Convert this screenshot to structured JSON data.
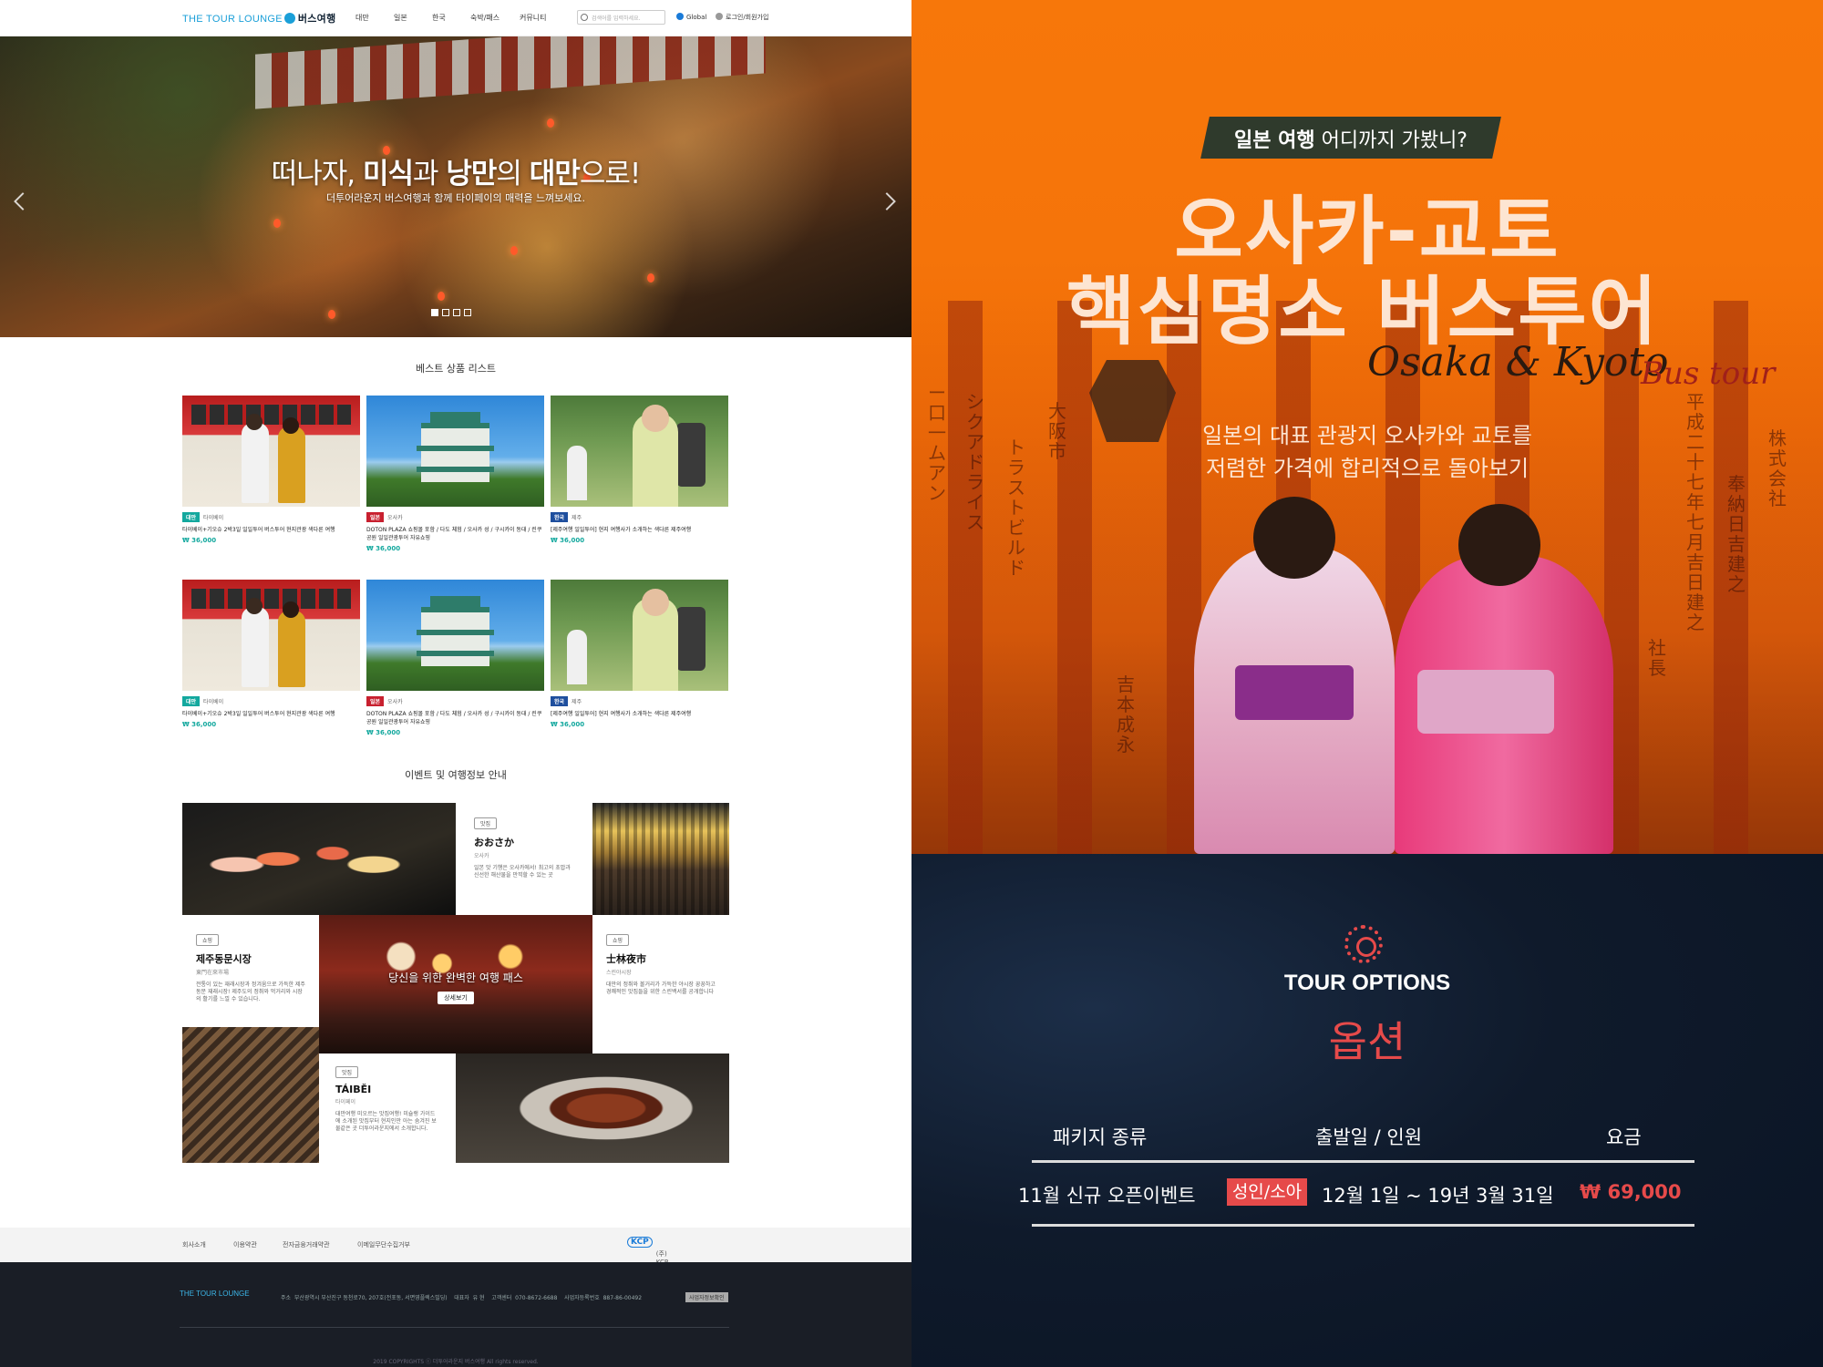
{
  "header": {
    "logo_text": "THE TOUR LOUNGE",
    "logo_sub": "버스여행",
    "nav": [
      "대만",
      "일본",
      "한국",
      "숙박/패스",
      "커뮤니티"
    ],
    "search_placeholder": "검색어를 입력하세요.",
    "global_label": "Global",
    "login_label": "로그인/회원가입"
  },
  "hero": {
    "title_pre": "떠나자, ",
    "title_b1": "미식",
    "title_mid1": "과 ",
    "title_b2": "낭만",
    "title_mid2": "의 ",
    "title_b3": "대만",
    "title_post": "으로!",
    "subtitle": "더투어라운지 버스여행과 함께 타이페이의 매력을 느껴보세요.",
    "slides": 4,
    "active_slide": 1
  },
  "best": {
    "title": "베스트 상품 리스트",
    "rows": [
      [
        {
          "badge": "대만",
          "region": "타이베이",
          "title": "타이베이+기오슈 2박3일 일일투어 버스투어 현지관광 색다른 여행",
          "price": "₩ 36,000"
        },
        {
          "badge": "일본",
          "region": "오사카",
          "title": "DOTON PLAZA 쇼핑몰 포함 / 다도 체험 / 오사카 성 / 구시카이 동대 / 린쿠공원 일일관광투어 자유쇼핑",
          "price": "₩ 36,000"
        },
        {
          "badge": "한국",
          "region": "제주",
          "title": "[제주여행 일일투어] 현지 여행사가 소개하는 색다른 제주여행",
          "price": "₩ 36,000"
        }
      ],
      [
        {
          "badge": "대만",
          "region": "타이베이",
          "title": "타이베이+기오슈 2박3일 일일투어 버스투어 현지관광 색다른 여행",
          "price": "₩ 36,000"
        },
        {
          "badge": "일본",
          "region": "오사카",
          "title": "DOTON PLAZA 쇼핑몰 포함 / 다도 체험 / 오사카 성 / 구시카이 동대 / 린쿠공원 일일관광투어 자유쇼핑",
          "price": "₩ 36,000"
        },
        {
          "badge": "한국",
          "region": "제주",
          "title": "[제주여행 일일투어] 현지 여행사가 소개하는 색다른 제주여행",
          "price": "₩ 36,000"
        }
      ]
    ]
  },
  "events": {
    "title": "이벤트 및 여행정보 안내",
    "osaka": {
      "tag": "맛집",
      "name": "おおさか",
      "sub": "오사카",
      "desc": "일본 맛 기행은 오사카에서! 최고의 초밥과 신선한 해산물을 만끽할 수 있는 곳"
    },
    "jeju": {
      "tag": "쇼핑",
      "name": "제주동문시장",
      "sub": "東門在來市場",
      "desc": "전통이 있는 재래시장과 정겨움으로 가득한 제주 동문 재래시장! 제주도의 정취와 먹거리와 시장의 활기를 느낄 수 있습니다."
    },
    "center": {
      "text": "당신을 위한 완벽한 여행 패스",
      "button": "상세보기"
    },
    "shilin": {
      "tag": "쇼핑",
      "name": "士林夜市",
      "sub": "스린야시장",
      "desc": "대만의 정취와 볼거리가 가득한 야시장 꿍꿍하고 경쾌적인 맛집들을 위한 스린백서를 공개합니다"
    },
    "taibei": {
      "tag": "맛집",
      "name": "TÁIBĚI",
      "sub": "타이페이",
      "desc": "대만여행 미오르는 맛집여행! 미슐랭 가이드에 소개된 맛집부터 현지인만 아는 숨겨진 보물같은 곳 더투어라운지에서 소개합니다."
    }
  },
  "footer": {
    "links": [
      "회사소개",
      "이용약관",
      "전자금융거래약관",
      "이메일무단수집거부"
    ],
    "kcp_logo": "KCP",
    "kcp_label": "(주) KCP 전자결제서비스",
    "logo_text": "THE TOUR LOUNGE",
    "address_label": "주소",
    "address": "부산광역시 부산진구 동천로70, 207호(전포동, 서면영플렉스빌딩)",
    "ceo_label": "대표자",
    "ceo": "유 현",
    "phone_label": "고객센터",
    "phone": "070-8672-6688",
    "biz_label": "사업자등록번호",
    "biz": "887-86-00492",
    "biz_btn": "사업자정보확인",
    "copyright": "2019 COPYRIGHTS ⓒ 더투어라운지 버스여행 All rights reserved."
  },
  "poster": {
    "banner_bold": "일본 여행",
    "banner_rest": " 어디까지 가봤니?",
    "title_line1": "오사카-교토",
    "title_line2": "핵심명소 버스투어",
    "script": "Osaka & Kyoto",
    "script2": "Bus tour",
    "sub_line1": "일본의 대표 관광지 오사카와 교토를",
    "sub_line2": "저렴한 가격에 합리적으로 돌아보기",
    "kanji": [
      "奉納日吉建之",
      "大阪市",
      "株式会社",
      "トラストビルド",
      "吉本成永",
      "平成二十七年七月吉日建之",
      "シクアドライス",
      "社長",
      "ー口一ムアン"
    ]
  },
  "options": {
    "icon": "gear-icon",
    "heading": "TOUR OPTIONS",
    "heading_kr": "옵션",
    "col_package": "패키지 종류",
    "col_date": "출발일 / 인원",
    "col_price": "요금",
    "row": {
      "package": "11월 신규 오픈이벤트",
      "age": "성인/소아",
      "date": "12월 1일 ~ 19년 3월 31일",
      "price": "₩ 69,000"
    }
  },
  "colors": {
    "accent_teal": "#13a89e",
    "accent_red": "#e64a4a",
    "orange": "#f5740a",
    "navy": "#0f1a2b"
  }
}
